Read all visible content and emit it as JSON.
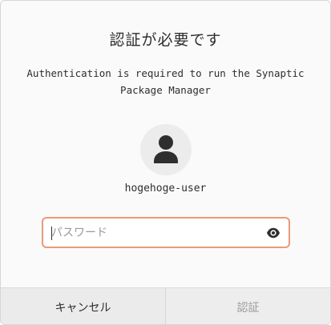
{
  "dialog": {
    "title": "認証が必要です",
    "message": "Authentication is required to run the Synaptic Package Manager",
    "username": "hogehoge-user",
    "password_placeholder": "パスワード",
    "cancel_label": "キャンセル",
    "authenticate_label": "認証"
  },
  "icons": {
    "avatar": "person-icon",
    "reveal": "eye-icon"
  },
  "colors": {
    "focus_border": "#e89a7a",
    "button_bg": "#ebebeb",
    "disabled_text": "#9c9c9c"
  }
}
